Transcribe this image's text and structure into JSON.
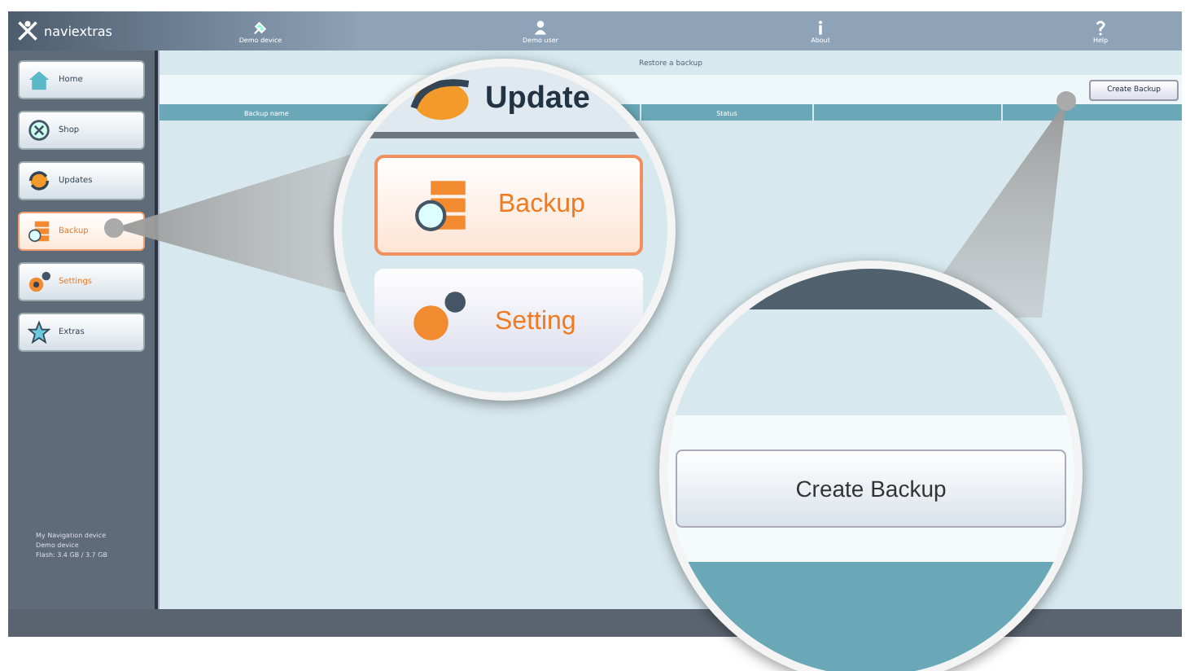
{
  "app": {
    "logo": "naviextras"
  },
  "toolbar": [
    {
      "label": "Demo device",
      "kind": "device"
    },
    {
      "label": "Demo user",
      "kind": "user"
    },
    {
      "label": "About",
      "kind": "info"
    },
    {
      "label": "Help",
      "kind": "help"
    }
  ],
  "sidebar": {
    "items": [
      {
        "label": "Home",
        "kind": "home",
        "selected": false,
        "highlighted": false
      },
      {
        "label": "Shop",
        "kind": "shop",
        "selected": false,
        "highlighted": false
      },
      {
        "label": "Updates",
        "kind": "updates",
        "selected": false,
        "highlighted": false
      },
      {
        "label": "Backup",
        "kind": "backup",
        "selected": true,
        "highlighted": true
      },
      {
        "label": "Settings",
        "kind": "settings",
        "selected": false,
        "highlighted": true
      },
      {
        "label": "Extras",
        "kind": "extras",
        "selected": false,
        "highlighted": false
      }
    ],
    "device_info": [
      "My Navigation device",
      "Demo device",
      "Flash: 3.4 GB / 3.7 GB"
    ]
  },
  "content": {
    "title": "Restore a backup",
    "create_button": "Create Backup",
    "table": {
      "columns": [
        "Backup name",
        "Status"
      ]
    }
  },
  "magnifier_left": {
    "title": "Update",
    "button": "Backup",
    "next": "Setting"
  },
  "magnifier_right": {
    "button": "Create Backup"
  }
}
